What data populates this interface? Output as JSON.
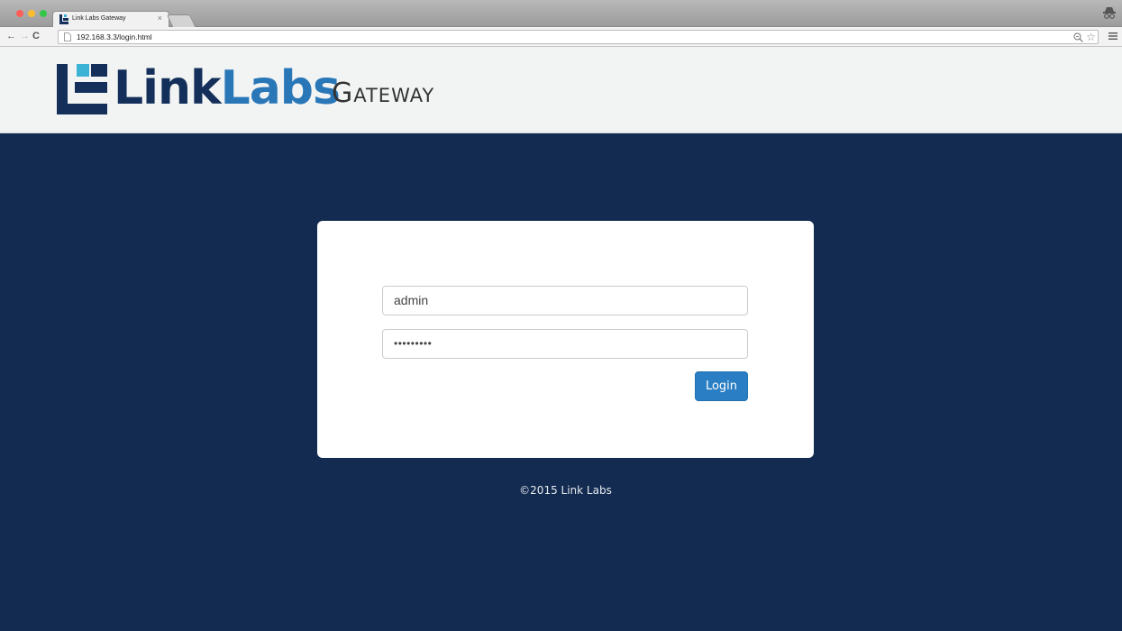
{
  "browser": {
    "tab_title": "Link Labs Gateway",
    "tab_close": "×",
    "url": "192.168.3.3/login.html",
    "nav": {
      "back": "←",
      "forward": "→",
      "reload": "C"
    },
    "star": "☆"
  },
  "header": {
    "brand_link": "Link",
    "brand_labs": "Labs",
    "product": "Gateway",
    "colors": {
      "navy": "#14305a",
      "blue": "#2a77b8",
      "teal": "#3ab3d4"
    }
  },
  "login": {
    "username_value": "admin",
    "password_value": "•••••••••",
    "button_label": "Login"
  },
  "footer": {
    "copyright": "©2015  Link Labs"
  },
  "colors": {
    "page_background": "#132b50",
    "button": "#2a7ec3",
    "header_background": "#f2f4f4"
  }
}
